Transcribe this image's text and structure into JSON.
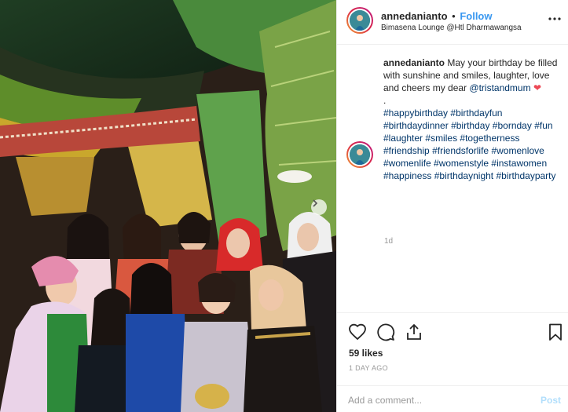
{
  "post": {
    "photo_alt": "group photo",
    "carousel_next_icon": "chevron-right-icon"
  },
  "header": {
    "username": "annedanianto",
    "separator": "•",
    "follow_label": "Follow",
    "location": "Bimasena Lounge @Htl Dharmawangsa",
    "more_icon": "more-options-icon"
  },
  "caption": {
    "username": "annedanianto",
    "text_before_mention": " May your birthday be filled with sunshine and smiles, laughter, love and cheers my dear ",
    "mention": "@tristandmum",
    "heart": "❤",
    "dot_line": ".",
    "hashtags": [
      "#happybirthday",
      "#birthdayfun",
      "#birthdaydinner",
      "#birthday",
      "#bornday",
      "#fun",
      "#laughter",
      "#smiles",
      "#togetherness",
      "#friendship",
      "#friendsforlife",
      "#womenlove",
      "#womenlife",
      "#womenstyle",
      "#instawomen",
      "#happiness",
      "#birthdaynight",
      "#birthdayparty"
    ],
    "time_ago": "1d"
  },
  "actions": {
    "like_icon": "heart-outline-icon",
    "comment_icon": "comment-icon",
    "share_icon": "share-icon",
    "save_icon": "bookmark-icon"
  },
  "likes": "59 likes",
  "date": "1 DAY AGO",
  "add_comment": {
    "placeholder": "Add a comment...",
    "post_label": "Post"
  }
}
